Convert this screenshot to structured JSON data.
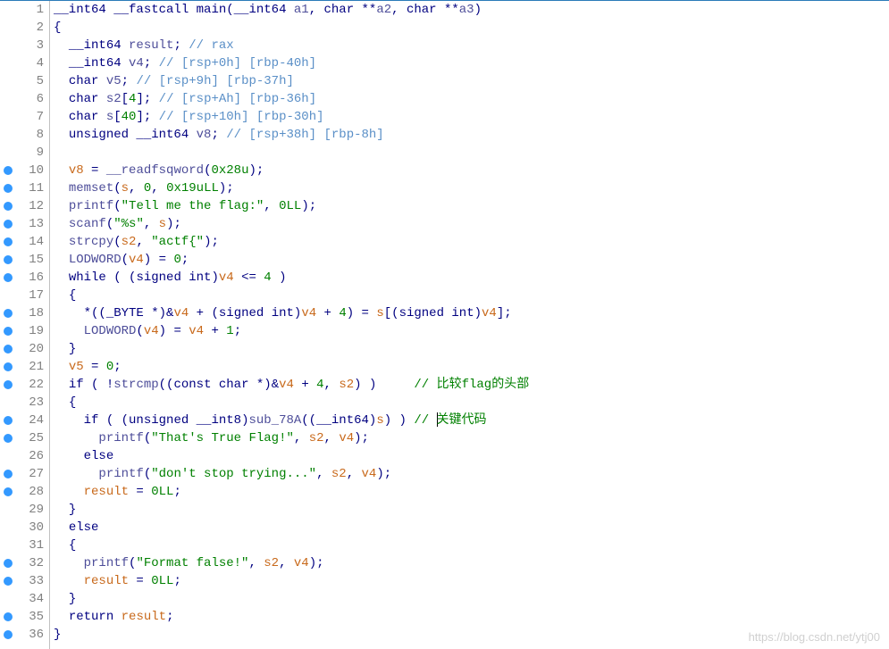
{
  "watermark": "https://blog.csdn.net/ytj00",
  "lines": [
    {
      "n": 1,
      "bp": false,
      "segs": [
        {
          "c": "typ",
          "t": "__int64 __fastcall "
        },
        {
          "c": "func",
          "t": "main"
        },
        {
          "c": "punct",
          "t": "("
        },
        {
          "c": "typ",
          "t": "__int64 "
        },
        {
          "c": "ident",
          "t": "a1"
        },
        {
          "c": "punct",
          "t": ", "
        },
        {
          "c": "typ",
          "t": "char "
        },
        {
          "c": "punct",
          "t": "**"
        },
        {
          "c": "ident",
          "t": "a2"
        },
        {
          "c": "punct",
          "t": ", "
        },
        {
          "c": "typ",
          "t": "char "
        },
        {
          "c": "punct",
          "t": "**"
        },
        {
          "c": "ident",
          "t": "a3"
        },
        {
          "c": "punct",
          "t": ")"
        }
      ]
    },
    {
      "n": 2,
      "bp": false,
      "segs": [
        {
          "c": "punct",
          "t": "{"
        }
      ]
    },
    {
      "n": 3,
      "bp": false,
      "segs": [
        {
          "c": "black",
          "t": "  "
        },
        {
          "c": "typ",
          "t": "__int64 "
        },
        {
          "c": "ident",
          "t": "result"
        },
        {
          "c": "punct",
          "t": "; "
        },
        {
          "c": "cmt-blue",
          "t": "// rax"
        }
      ]
    },
    {
      "n": 4,
      "bp": false,
      "segs": [
        {
          "c": "black",
          "t": "  "
        },
        {
          "c": "typ",
          "t": "__int64 "
        },
        {
          "c": "ident",
          "t": "v4"
        },
        {
          "c": "punct",
          "t": "; "
        },
        {
          "c": "cmt-blue",
          "t": "// [rsp+0h] [rbp-40h]"
        }
      ]
    },
    {
      "n": 5,
      "bp": false,
      "segs": [
        {
          "c": "black",
          "t": "  "
        },
        {
          "c": "typ",
          "t": "char "
        },
        {
          "c": "ident",
          "t": "v5"
        },
        {
          "c": "punct",
          "t": "; "
        },
        {
          "c": "cmt-blue",
          "t": "// [rsp+9h] [rbp-37h]"
        }
      ]
    },
    {
      "n": 6,
      "bp": false,
      "segs": [
        {
          "c": "black",
          "t": "  "
        },
        {
          "c": "typ",
          "t": "char "
        },
        {
          "c": "ident",
          "t": "s2"
        },
        {
          "c": "punct",
          "t": "["
        },
        {
          "c": "num",
          "t": "4"
        },
        {
          "c": "punct",
          "t": "]; "
        },
        {
          "c": "cmt-blue",
          "t": "// [rsp+Ah] [rbp-36h]"
        }
      ]
    },
    {
      "n": 7,
      "bp": false,
      "segs": [
        {
          "c": "black",
          "t": "  "
        },
        {
          "c": "typ",
          "t": "char "
        },
        {
          "c": "ident",
          "t": "s"
        },
        {
          "c": "punct",
          "t": "["
        },
        {
          "c": "num",
          "t": "40"
        },
        {
          "c": "punct",
          "t": "]; "
        },
        {
          "c": "cmt-blue",
          "t": "// [rsp+10h] [rbp-30h]"
        }
      ]
    },
    {
      "n": 8,
      "bp": false,
      "segs": [
        {
          "c": "black",
          "t": "  "
        },
        {
          "c": "typ",
          "t": "unsigned __int64 "
        },
        {
          "c": "ident",
          "t": "v8"
        },
        {
          "c": "punct",
          "t": "; "
        },
        {
          "c": "cmt-blue",
          "t": "// [rsp+38h] [rbp-8h]"
        }
      ]
    },
    {
      "n": 9,
      "bp": false,
      "segs": []
    },
    {
      "n": 10,
      "bp": true,
      "segs": [
        {
          "c": "black",
          "t": "  "
        },
        {
          "c": "var",
          "t": "v8"
        },
        {
          "c": "punct",
          "t": " = "
        },
        {
          "c": "call",
          "t": "__readfsqword"
        },
        {
          "c": "punct",
          "t": "("
        },
        {
          "c": "num",
          "t": "0x28u"
        },
        {
          "c": "punct",
          "t": ");"
        }
      ]
    },
    {
      "n": 11,
      "bp": true,
      "segs": [
        {
          "c": "black",
          "t": "  "
        },
        {
          "c": "call",
          "t": "memset"
        },
        {
          "c": "punct",
          "t": "("
        },
        {
          "c": "var",
          "t": "s"
        },
        {
          "c": "punct",
          "t": ", "
        },
        {
          "c": "num",
          "t": "0"
        },
        {
          "c": "punct",
          "t": ", "
        },
        {
          "c": "num",
          "t": "0x19uLL"
        },
        {
          "c": "punct",
          "t": ");"
        }
      ]
    },
    {
      "n": 12,
      "bp": true,
      "segs": [
        {
          "c": "black",
          "t": "  "
        },
        {
          "c": "call",
          "t": "printf"
        },
        {
          "c": "punct",
          "t": "("
        },
        {
          "c": "str",
          "t": "\"Tell me the flag:\""
        },
        {
          "c": "punct",
          "t": ", "
        },
        {
          "c": "num",
          "t": "0LL"
        },
        {
          "c": "punct",
          "t": ");"
        }
      ]
    },
    {
      "n": 13,
      "bp": true,
      "segs": [
        {
          "c": "black",
          "t": "  "
        },
        {
          "c": "call",
          "t": "scanf"
        },
        {
          "c": "punct",
          "t": "("
        },
        {
          "c": "str",
          "t": "\"%s\""
        },
        {
          "c": "punct",
          "t": ", "
        },
        {
          "c": "var",
          "t": "s"
        },
        {
          "c": "punct",
          "t": ");"
        }
      ]
    },
    {
      "n": 14,
      "bp": true,
      "segs": [
        {
          "c": "black",
          "t": "  "
        },
        {
          "c": "call",
          "t": "strcpy"
        },
        {
          "c": "punct",
          "t": "("
        },
        {
          "c": "var",
          "t": "s2"
        },
        {
          "c": "punct",
          "t": ", "
        },
        {
          "c": "str",
          "t": "\"actf{\""
        },
        {
          "c": "punct",
          "t": ");"
        }
      ]
    },
    {
      "n": 15,
      "bp": true,
      "segs": [
        {
          "c": "black",
          "t": "  "
        },
        {
          "c": "call",
          "t": "LODWORD"
        },
        {
          "c": "punct",
          "t": "("
        },
        {
          "c": "var",
          "t": "v4"
        },
        {
          "c": "punct",
          "t": ") = "
        },
        {
          "c": "num",
          "t": "0"
        },
        {
          "c": "punct",
          "t": ";"
        }
      ]
    },
    {
      "n": 16,
      "bp": true,
      "segs": [
        {
          "c": "black",
          "t": "  "
        },
        {
          "c": "kw",
          "t": "while"
        },
        {
          "c": "punct",
          "t": " ( ("
        },
        {
          "c": "typ",
          "t": "signed int"
        },
        {
          "c": "punct",
          "t": ")"
        },
        {
          "c": "var",
          "t": "v4"
        },
        {
          "c": "punct",
          "t": " <= "
        },
        {
          "c": "num",
          "t": "4"
        },
        {
          "c": "punct",
          "t": " )"
        }
      ]
    },
    {
      "n": 17,
      "bp": false,
      "segs": [
        {
          "c": "black",
          "t": "  "
        },
        {
          "c": "punct",
          "t": "{"
        }
      ]
    },
    {
      "n": 18,
      "bp": true,
      "segs": [
        {
          "c": "black",
          "t": "    "
        },
        {
          "c": "punct",
          "t": "*(("
        },
        {
          "c": "typ",
          "t": "_BYTE "
        },
        {
          "c": "punct",
          "t": "*)&"
        },
        {
          "c": "var",
          "t": "v4"
        },
        {
          "c": "punct",
          "t": " + ("
        },
        {
          "c": "typ",
          "t": "signed int"
        },
        {
          "c": "punct",
          "t": ")"
        },
        {
          "c": "var",
          "t": "v4"
        },
        {
          "c": "punct",
          "t": " + "
        },
        {
          "c": "num",
          "t": "4"
        },
        {
          "c": "punct",
          "t": ") = "
        },
        {
          "c": "var",
          "t": "s"
        },
        {
          "c": "punct",
          "t": "[("
        },
        {
          "c": "typ",
          "t": "signed int"
        },
        {
          "c": "punct",
          "t": ")"
        },
        {
          "c": "var",
          "t": "v4"
        },
        {
          "c": "punct",
          "t": "];"
        }
      ]
    },
    {
      "n": 19,
      "bp": true,
      "segs": [
        {
          "c": "black",
          "t": "    "
        },
        {
          "c": "call",
          "t": "LODWORD"
        },
        {
          "c": "punct",
          "t": "("
        },
        {
          "c": "var",
          "t": "v4"
        },
        {
          "c": "punct",
          "t": ") = "
        },
        {
          "c": "var",
          "t": "v4"
        },
        {
          "c": "punct",
          "t": " + "
        },
        {
          "c": "num",
          "t": "1"
        },
        {
          "c": "punct",
          "t": ";"
        }
      ]
    },
    {
      "n": 20,
      "bp": true,
      "segs": [
        {
          "c": "black",
          "t": "  "
        },
        {
          "c": "punct",
          "t": "}"
        }
      ]
    },
    {
      "n": 21,
      "bp": true,
      "segs": [
        {
          "c": "black",
          "t": "  "
        },
        {
          "c": "var",
          "t": "v5"
        },
        {
          "c": "punct",
          "t": " = "
        },
        {
          "c": "num",
          "t": "0"
        },
        {
          "c": "punct",
          "t": ";"
        }
      ]
    },
    {
      "n": 22,
      "bp": true,
      "segs": [
        {
          "c": "black",
          "t": "  "
        },
        {
          "c": "kw",
          "t": "if"
        },
        {
          "c": "punct",
          "t": " ( !"
        },
        {
          "c": "call",
          "t": "strcmp"
        },
        {
          "c": "punct",
          "t": "(("
        },
        {
          "c": "typ",
          "t": "const char "
        },
        {
          "c": "punct",
          "t": "*)&"
        },
        {
          "c": "var",
          "t": "v4"
        },
        {
          "c": "punct",
          "t": " + "
        },
        {
          "c": "num",
          "t": "4"
        },
        {
          "c": "punct",
          "t": ", "
        },
        {
          "c": "var",
          "t": "s2"
        },
        {
          "c": "punct",
          "t": ") )     "
        },
        {
          "c": "cmt-green",
          "t": "// 比较flag的头部"
        }
      ]
    },
    {
      "n": 23,
      "bp": false,
      "segs": [
        {
          "c": "black",
          "t": "  "
        },
        {
          "c": "punct",
          "t": "{"
        }
      ]
    },
    {
      "n": 24,
      "bp": true,
      "segs": [
        {
          "c": "black",
          "t": "    "
        },
        {
          "c": "kw",
          "t": "if"
        },
        {
          "c": "punct",
          "t": " ( ("
        },
        {
          "c": "typ",
          "t": "unsigned __int8"
        },
        {
          "c": "punct",
          "t": ")"
        },
        {
          "c": "call",
          "t": "sub_78A"
        },
        {
          "c": "punct",
          "t": "(("
        },
        {
          "c": "typ",
          "t": "__int64"
        },
        {
          "c": "punct",
          "t": ")"
        },
        {
          "c": "var",
          "t": "s"
        },
        {
          "c": "punct",
          "t": ") ) "
        },
        {
          "c": "cmt-green",
          "t": "// "
        },
        {
          "c": "cursor",
          "t": ""
        },
        {
          "c": "cmt-green",
          "t": "关键代码"
        }
      ]
    },
    {
      "n": 25,
      "bp": true,
      "segs": [
        {
          "c": "black",
          "t": "      "
        },
        {
          "c": "call",
          "t": "printf"
        },
        {
          "c": "punct",
          "t": "("
        },
        {
          "c": "str",
          "t": "\"That's True Flag!\""
        },
        {
          "c": "punct",
          "t": ", "
        },
        {
          "c": "var",
          "t": "s2"
        },
        {
          "c": "punct",
          "t": ", "
        },
        {
          "c": "var",
          "t": "v4"
        },
        {
          "c": "punct",
          "t": ");"
        }
      ]
    },
    {
      "n": 26,
      "bp": false,
      "segs": [
        {
          "c": "black",
          "t": "    "
        },
        {
          "c": "kw",
          "t": "else"
        }
      ]
    },
    {
      "n": 27,
      "bp": true,
      "segs": [
        {
          "c": "black",
          "t": "      "
        },
        {
          "c": "call",
          "t": "printf"
        },
        {
          "c": "punct",
          "t": "("
        },
        {
          "c": "str",
          "t": "\"don't stop trying...\""
        },
        {
          "c": "punct",
          "t": ", "
        },
        {
          "c": "var",
          "t": "s2"
        },
        {
          "c": "punct",
          "t": ", "
        },
        {
          "c": "var",
          "t": "v4"
        },
        {
          "c": "punct",
          "t": ");"
        }
      ]
    },
    {
      "n": 28,
      "bp": true,
      "segs": [
        {
          "c": "black",
          "t": "    "
        },
        {
          "c": "var",
          "t": "result"
        },
        {
          "c": "punct",
          "t": " = "
        },
        {
          "c": "num",
          "t": "0LL"
        },
        {
          "c": "punct",
          "t": ";"
        }
      ]
    },
    {
      "n": 29,
      "bp": false,
      "segs": [
        {
          "c": "black",
          "t": "  "
        },
        {
          "c": "punct",
          "t": "}"
        }
      ]
    },
    {
      "n": 30,
      "bp": false,
      "segs": [
        {
          "c": "black",
          "t": "  "
        },
        {
          "c": "kw",
          "t": "else"
        }
      ]
    },
    {
      "n": 31,
      "bp": false,
      "segs": [
        {
          "c": "black",
          "t": "  "
        },
        {
          "c": "punct",
          "t": "{"
        }
      ]
    },
    {
      "n": 32,
      "bp": true,
      "segs": [
        {
          "c": "black",
          "t": "    "
        },
        {
          "c": "call",
          "t": "printf"
        },
        {
          "c": "punct",
          "t": "("
        },
        {
          "c": "str",
          "t": "\"Format false!\""
        },
        {
          "c": "punct",
          "t": ", "
        },
        {
          "c": "var",
          "t": "s2"
        },
        {
          "c": "punct",
          "t": ", "
        },
        {
          "c": "var",
          "t": "v4"
        },
        {
          "c": "punct",
          "t": ");"
        }
      ]
    },
    {
      "n": 33,
      "bp": true,
      "segs": [
        {
          "c": "black",
          "t": "    "
        },
        {
          "c": "var",
          "t": "result"
        },
        {
          "c": "punct",
          "t": " = "
        },
        {
          "c": "num",
          "t": "0LL"
        },
        {
          "c": "punct",
          "t": ";"
        }
      ]
    },
    {
      "n": 34,
      "bp": false,
      "segs": [
        {
          "c": "black",
          "t": "  "
        },
        {
          "c": "punct",
          "t": "}"
        }
      ]
    },
    {
      "n": 35,
      "bp": true,
      "segs": [
        {
          "c": "black",
          "t": "  "
        },
        {
          "c": "kw",
          "t": "return"
        },
        {
          "c": "punct",
          "t": " "
        },
        {
          "c": "var",
          "t": "result"
        },
        {
          "c": "punct",
          "t": ";"
        }
      ]
    },
    {
      "n": 36,
      "bp": true,
      "segs": [
        {
          "c": "punct",
          "t": "}"
        }
      ]
    }
  ]
}
